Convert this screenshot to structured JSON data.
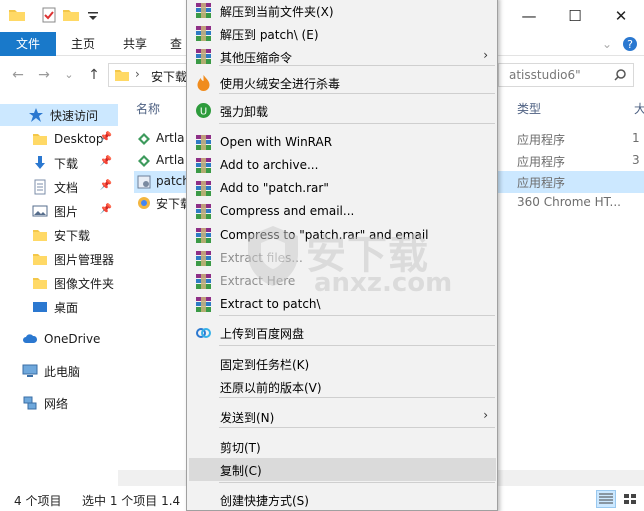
{
  "window": {
    "minimize_glyph": "—",
    "maximize_glyph": "☐",
    "close_glyph": "✕"
  },
  "ribbon": {
    "tabs": [
      "文件",
      "主页",
      "共享",
      "查"
    ],
    "collapse_glyph": "⌄",
    "help_glyph": "?"
  },
  "address": {
    "back_glyph": "←",
    "forward_glyph": "→",
    "dropdown_glyph": "⌄",
    "up_glyph": "↑",
    "path_sep": "›",
    "path": "安下载",
    "search_tail": "atisstudio6\"",
    "search_icon": "search-icon"
  },
  "nav": {
    "items": [
      {
        "label": "快速访问",
        "icon": "star-icon",
        "selected": true,
        "pinned": false
      },
      {
        "label": "Desktop",
        "icon": "folder-icon",
        "selected": false,
        "pinned": true
      },
      {
        "label": "下载",
        "icon": "download-icon",
        "selected": false,
        "pinned": true
      },
      {
        "label": "文档",
        "icon": "document-icon",
        "selected": false,
        "pinned": true
      },
      {
        "label": "图片",
        "icon": "picture-icon",
        "selected": false,
        "pinned": true
      },
      {
        "label": "安下载",
        "icon": "folder-icon",
        "selected": false,
        "pinned": false
      },
      {
        "label": "图片管理器",
        "icon": "folder-icon",
        "selected": false,
        "pinned": false
      },
      {
        "label": "图像文件夹",
        "icon": "folder-icon",
        "selected": false,
        "pinned": false
      },
      {
        "label": "桌面",
        "icon": "desktop-icon",
        "selected": false,
        "pinned": false
      },
      {
        "label": "OneDrive",
        "icon": "cloud-icon",
        "selected": false,
        "pinned": false
      },
      {
        "label": "此电脑",
        "icon": "computer-icon",
        "selected": false,
        "pinned": false
      },
      {
        "label": "网络",
        "icon": "network-icon",
        "selected": false,
        "pinned": false
      }
    ],
    "pin_glyph": "📌"
  },
  "content": {
    "col_name": "名称",
    "col_type": "类型",
    "col_extra": "大",
    "files": [
      {
        "name": "Artla",
        "type": "应用程序",
        "size": "1",
        "icon": "app-icon",
        "selected": false
      },
      {
        "name": "Artla",
        "type": "应用程序",
        "size": "3",
        "icon": "app-icon",
        "selected": false
      },
      {
        "name": "patch",
        "type": "应用程序",
        "size": "",
        "icon": "patch-icon",
        "selected": true
      },
      {
        "name": "安下载",
        "type": "360 Chrome HT...",
        "size": "",
        "icon": "html-icon",
        "selected": false
      }
    ]
  },
  "status": {
    "count": "4 个项目",
    "selected": "选中 1 个项目 1.4"
  },
  "menu": {
    "items": [
      {
        "label": "解压到当前文件夹(X)",
        "icon": "winrar-icon",
        "disabled": false,
        "submenu": false,
        "hover": false
      },
      {
        "label": "解压到 patch\\ (E)",
        "icon": "winrar-icon",
        "disabled": false,
        "submenu": false,
        "hover": false
      },
      {
        "label": "其他压缩命令",
        "icon": "winrar-icon",
        "disabled": false,
        "submenu": true,
        "hover": false
      },
      {
        "label": "使用火绒安全进行杀毒",
        "icon": "huorong-icon",
        "disabled": false,
        "submenu": false,
        "hover": false
      },
      {
        "label": "强力卸载",
        "icon": "uninstall-icon",
        "disabled": false,
        "submenu": false,
        "hover": false
      },
      {
        "label": "Open with WinRAR",
        "icon": "winrar-icon",
        "disabled": false,
        "submenu": false,
        "hover": false
      },
      {
        "label": "Add to archive...",
        "icon": "winrar-icon",
        "disabled": false,
        "submenu": false,
        "hover": false
      },
      {
        "label": "Add to \"patch.rar\"",
        "icon": "winrar-icon",
        "disabled": false,
        "submenu": false,
        "hover": false
      },
      {
        "label": "Compress and email...",
        "icon": "winrar-icon",
        "disabled": false,
        "submenu": false,
        "hover": false
      },
      {
        "label": "Compress to \"patch.rar\" and email",
        "icon": "winrar-icon",
        "disabled": false,
        "submenu": false,
        "hover": false
      },
      {
        "label": "Extract files...",
        "icon": "winrar-icon",
        "disabled": true,
        "submenu": false,
        "hover": false
      },
      {
        "label": "Extract Here",
        "icon": "winrar-icon",
        "disabled": true,
        "submenu": false,
        "hover": false
      },
      {
        "label": "Extract to patch\\",
        "icon": "winrar-icon",
        "disabled": false,
        "submenu": false,
        "hover": false
      },
      {
        "label": "上传到百度网盘",
        "icon": "baidu-icon",
        "disabled": false,
        "submenu": false,
        "hover": false
      },
      {
        "label": "固定到任务栏(K)",
        "icon": "",
        "disabled": false,
        "submenu": false,
        "hover": false
      },
      {
        "label": "还原以前的版本(V)",
        "icon": "",
        "disabled": false,
        "submenu": false,
        "hover": false
      },
      {
        "label": "发送到(N)",
        "icon": "",
        "disabled": false,
        "submenu": true,
        "hover": false
      },
      {
        "label": "剪切(T)",
        "icon": "",
        "disabled": false,
        "submenu": false,
        "hover": false
      },
      {
        "label": "复制(C)",
        "icon": "",
        "disabled": false,
        "submenu": false,
        "hover": true
      },
      {
        "label": "创建快捷方式(S)",
        "icon": "",
        "disabled": false,
        "submenu": false,
        "hover": false
      }
    ],
    "arrow_glyph": "›"
  },
  "watermark": {
    "text": "安下载",
    "sub": "anxz.com"
  }
}
